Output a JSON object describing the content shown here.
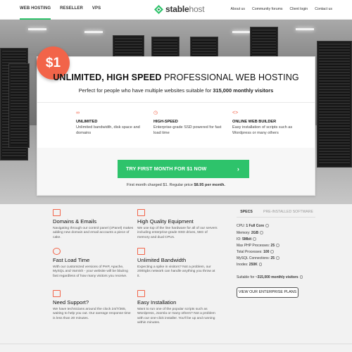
{
  "nav": {
    "left": [
      "WEB HOSTING",
      "RESELLER",
      "VPS"
    ],
    "brand_main": "stable",
    "brand_sub": "host",
    "right": [
      "About us",
      "Community forums",
      "Client login",
      "Contact us"
    ]
  },
  "hero": {
    "badge": "$1",
    "title_bold": "UNLIMITED, HIGH SPEED",
    "title_rest": " PROFESSIONAL WEB HOSTING",
    "subtitle_pre": "Perfect for people who have multiple websites suitable for ",
    "subtitle_bold": "315,000 monthly visitors",
    "features": [
      {
        "icon": "link-icon",
        "glyph": "∞",
        "title": "UNLIMITED",
        "desc": "Unlimited bandwidth, disk space and domains"
      },
      {
        "icon": "speed-icon",
        "glyph": "◷",
        "title": "HIGH-SPEED",
        "desc": "Enterprise-grade SSD powered for fast load time"
      },
      {
        "icon": "code-icon",
        "glyph": "<>",
        "title": "ONLINE WEB BUILDER",
        "desc": "Easy installation of scripts such as Wordpress or many others"
      }
    ],
    "cta_label": "TRY FIRST MONTH FOR $1 NOW",
    "cta_arrow": "›",
    "note_pre": "First month charged $1. Regular price ",
    "note_bold": "$8.95 per month."
  },
  "features": [
    {
      "icon": "mail-icon",
      "title": "Domains & Emails",
      "desc": "Navigating through our control panel (cPanel) makes adding new domain and email accounts a piece of cake."
    },
    {
      "icon": "cpu-icon",
      "title": "High Quality Equipment",
      "desc": "We use top of the line hardware for all of our servers including enterprise-grade SSD drives, 56G of memory and dual CPUs."
    },
    {
      "icon": "clock-icon",
      "title": "Fast Load Time",
      "desc": "With our customized versions of PHP, Apache, MySQL and Varnish - your website will be blazing fast regardless of how many visitors you receive."
    },
    {
      "icon": "bandwidth-icon",
      "title": "Unlimited Bandwidth",
      "desc": "Expecting a spike in visitors? Not a problem, our 2000gbs network can handle anything you throw at it."
    },
    {
      "icon": "chat-icon",
      "title": "Need Support?",
      "desc": "We have technicians around the clock 24/7/365, waiting to help you out. Our average response time is less than 20 minutes."
    },
    {
      "icon": "install-icon",
      "title": "Easy Installation",
      "desc": "Want to run one of the popular scripts such as Wordpress, Joomla or many others? Not a problem with our one-click installer. You'll be up and running within minutes."
    }
  ],
  "specs": {
    "tab_active": "SPECS",
    "tab_other": "PRE-INSTALLED SOFTWARE",
    "rows": [
      {
        "label": "CPU: ",
        "value": "1 Full Core"
      },
      {
        "label": "Memory: ",
        "value": "2GB"
      },
      {
        "label": "IO: ",
        "value": "5Mbit"
      },
      {
        "label": "Max PHP Processes: ",
        "value": "25"
      },
      {
        "label": "Total Processes: ",
        "value": "100"
      },
      {
        "label": "MySQL Connections: ",
        "value": "25"
      },
      {
        "label": "Inodes: ",
        "value": "250K"
      }
    ],
    "suitable_pre": "Suitable for ",
    "suitable_bold": "~315,000 monthly visitors",
    "button": "VIEW OUR ENTERPRISE PLANS"
  },
  "colors": {
    "accent": "#2ec36b",
    "brand_red": "#f26449"
  }
}
